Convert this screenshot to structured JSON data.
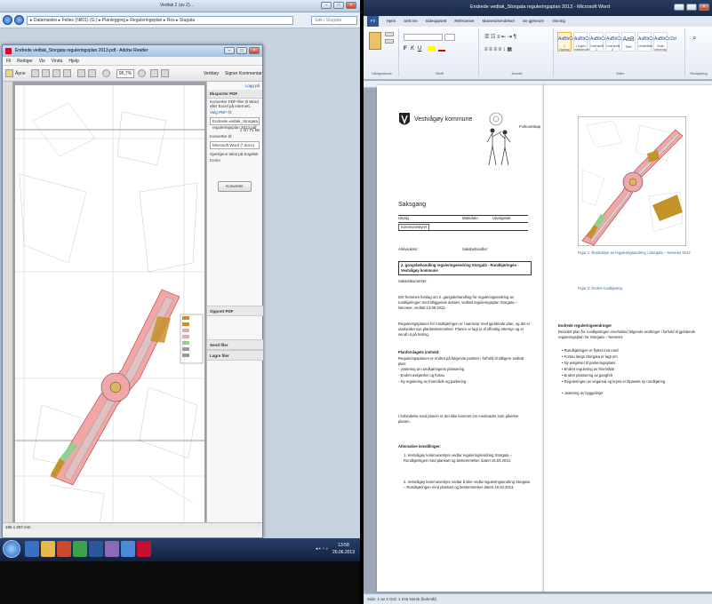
{
  "left": {
    "explorer": {
      "title": "Vedtak 2 (av 2)…",
      "address": "▸ Datamaskin ▸ Felles (\\\\fil01) (G:) ▸ Planlegging ▸ Reguleringsplan ▸ Ros ▸ Stugata",
      "search_placeholder": "Søk i Stugata"
    },
    "pdf": {
      "window_title": "Endrede vedtak_Storgata reguleringsplan 2013.pdf - Adobe Reader",
      "menu": [
        "Fil",
        "Rediger",
        "Vis",
        "Vindu",
        "Hjelp"
      ],
      "toolbar_open": "Åpne",
      "zoom": "95,7%",
      "tools": [
        "Verktøy",
        "Signer",
        "Kommentar"
      ],
      "panel": {
        "sign_in": "Logg på",
        "export_header": "Eksporter PDF",
        "export_desc": "Konverter PDF-filer til Word eller Excel på Internett.",
        "select_file": "Velg PDF-fil:",
        "file": "Endrede vedtak_Storgata reguleringsplan 2013.pdf",
        "pages": "1 fil / 71 kB",
        "convert_to": "Konverter til:",
        "format": "Microsoft Word (*.docx)",
        "ocr": "Gjenkjenn tekst på Engelsk",
        "ocr_change": "Endre",
        "convert_btn": "Konverter",
        "sections": [
          "Opprett PDF",
          "Send filer",
          "Lagre filer"
        ]
      },
      "status": "196 x 297 mm"
    },
    "tray_time": "13:58",
    "tray_date": "26.06.2013"
  },
  "right": {
    "word": {
      "title": "Endrede vedtak_Storgata reguleringsplan 2013 - Microsoft Word",
      "tabs": [
        "Fil",
        "Hjem",
        "Sett inn",
        "Sideoppsett",
        "Referanser",
        "Masseutsendelser",
        "Se gjennom",
        "Visning"
      ],
      "styles": [
        {
          "sample": "AaBbCcDd",
          "name": "1 Normal"
        },
        {
          "sample": "AaBbCcDd",
          "name": "1 Ingen mellomrom"
        },
        {
          "sample": "AaBbCc",
          "name": "Overskrift 1"
        },
        {
          "sample": "AaBbCc",
          "name": "Overskrift 2"
        },
        {
          "sample": "AaB",
          "name": "Tittel"
        },
        {
          "sample": "AaBbCc.",
          "name": "Undertittel"
        },
        {
          "sample": "AaBbCcDd",
          "name": "Svak utheving"
        }
      ],
      "ribbon_groups": [
        "Utklippstavle",
        "Skrift",
        "Avsnitt",
        "Stiler",
        "Redigering"
      ],
      "status": "Side: 1 av 2   Ord: 1 246   Norsk (bokmål)"
    },
    "page1": {
      "org": "Vestvågøy kommune",
      "crest_label": "Forkunnskap",
      "doc_type": "Saksgang",
      "cols": [
        "Utvalg",
        "Møtedato",
        "Utvalgssak"
      ],
      "row": [
        "Kommunestyret",
        "",
        ""
      ],
      "meta_left": "Arkivsaksnr:",
      "meta_right": "Saksbehandler:",
      "subject": "2. gangsbehandling reguleringsendring Storgata - Rundkjøringen - Vestvågøy kommune",
      "rad": "Saksdokumenter:",
      "p1": "Det fremmes forslag om 2. gangsbehandling for reguleringsendring av rundkjøringen med tilliggende arealer, vedtatt reguleringsplan Storgata – Nerveiet, vedtatt 13.09.2013.",
      "p2": "Reguleringsplanen for rundkjøringen er i samsvar med gjeldende plan, og det er utarbeidet nye planbestemmelser. Planen er lagt ut til offentlig ettersyn og er sendt ut på høring.",
      "h1": "Planforslagets innhold:",
      "p3": "Reguleringsplanen er endret på følgende punkter i forhold til tidligere vedtatt plan:",
      "bullets": [
        "- Justering av rundkjøringens plassering",
        "- Endret avkjørsler og fortau",
        "- Ny regulering av friområde og parkering"
      ],
      "p4": "I forbindelse med planen er det ikke kommet inn merknader som påvirker planen.",
      "h2": "Alternative innstillinger:",
      "alt": [
        "1. Vestvågøy kommunestyre vedtar reguleringsendring Storgata – Rundkjøringen med plankart og bestemmelser datert 16.04.2013.",
        "2. Vestvågøy kommunestyre vedtar å ikke vedta reguleringsendring Storgata – Rundkjøringen med plankart og bestemmelser datert 16.04.2013."
      ]
    },
    "page2": {
      "caption1": "Figur 1: Illustrasjon av reguleringsendring i Storgata – Nerveiet 2013",
      "caption2": "Figur 2: Endret rundkjøring",
      "h1": "Endrede reguleringsendringer",
      "intro": "Revidert plan for rundkjøringen inneholder følgende endringer i forhold til gjeldende reguleringsplan for Storgata – Nerveiet:",
      "bullets": [
        "Rundkjøringen er flyttet mot nord",
        "Fortau langs Storgata er lagt om",
        "Ny avkjørsel til parkeringsplass",
        "Endret regulering av friområde",
        "Endret plassering av gangfelt",
        "Reguleringen av vegareal og kryss er tilpasset ny rundkjøring",
        "Justering av byggelinjer"
      ]
    }
  }
}
